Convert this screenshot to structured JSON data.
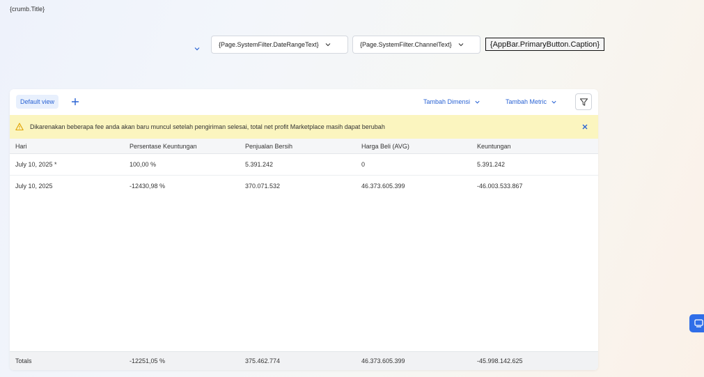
{
  "breadcrumb": {
    "title": "{crumb.Title}"
  },
  "filters": {
    "date_range": "{Page.SystemFilter.DateRangeText}",
    "channel": "{Page.SystemFilter.ChannelText}",
    "primary_button": "{AppBar.PrimaryButton.Caption}"
  },
  "toolbar": {
    "view_label": "Default view",
    "add_dimension": "Tambah Dimensi",
    "add_metric": "Tambah Metric"
  },
  "banner": {
    "message": "Dikarenakan beberapa fee anda akan baru muncul setelah pengiriman selesai, total net profit Marketplace masih dapat berubah"
  },
  "table": {
    "columns": [
      "Hari",
      "Persentase Keuntungan",
      "Penjualan Bersih",
      "Harga Beli (AVG)",
      "Keuntungan"
    ],
    "rows": [
      [
        "July 10, 2025 *",
        "100,00 %",
        "5.391.242",
        "0",
        "5.391.242"
      ],
      [
        "July 10, 2025",
        "-12430,98 %",
        "370.071.532",
        "46.373.605.399",
        "-46.003.533.867"
      ]
    ],
    "totals": [
      "Totals",
      "-12251,05 %",
      "375.462.774",
      "46.373.605.399",
      "-45.998.142.625"
    ]
  },
  "colors": {
    "accent": "#2a63d4",
    "banner_bg": "#fbf5bf",
    "warning_icon": "#e0a100"
  }
}
